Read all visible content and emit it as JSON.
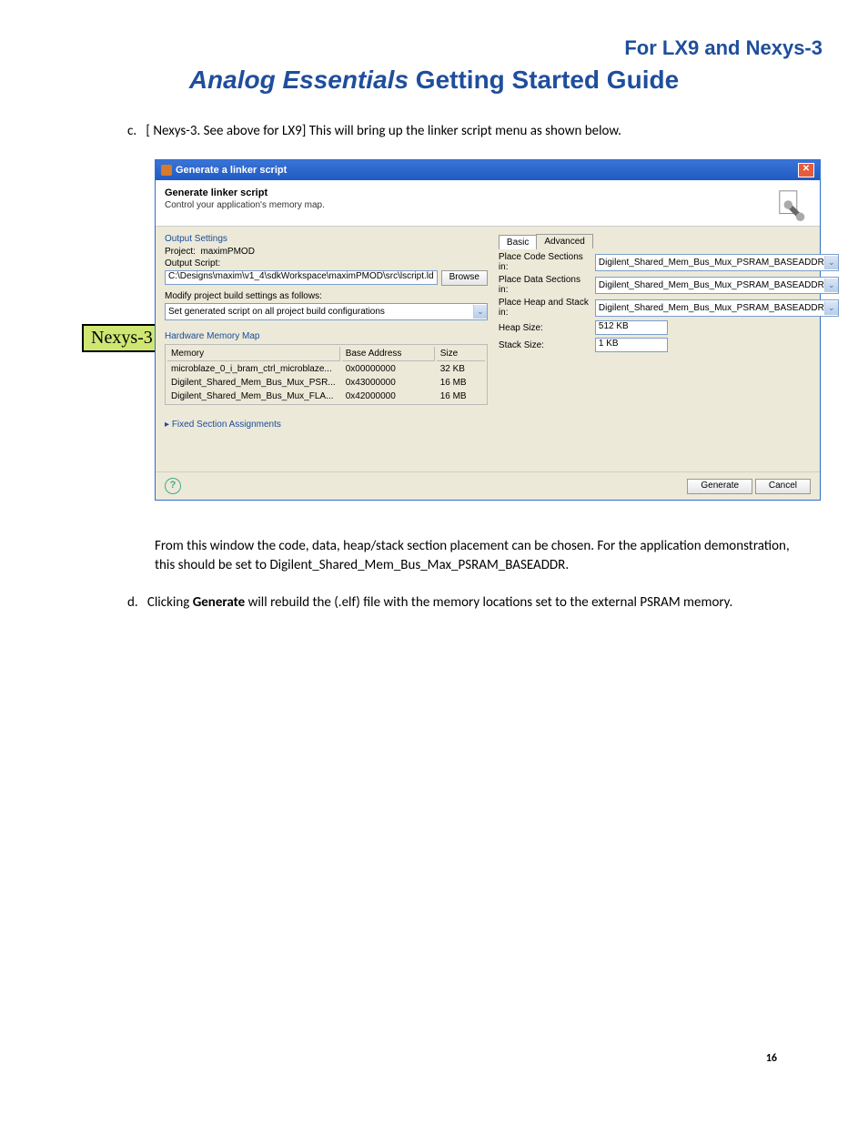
{
  "header": {
    "right": "For LX9 and Nexys-3",
    "title_italic": "Analog Essentials",
    "title_rest": " Getting Started Guide"
  },
  "sidebar_tag": "Nexys-3",
  "para_c_marker": "c.",
  "para_c": "[ Nexys-3. See above for LX9] This will bring up the linker script menu as shown below.",
  "para_after": "From this window the code, data, heap/stack section placement can be chosen. For the application demonstration, this should be set to Digilent_Shared_Mem_Bus_Max_PSRAM_BASEADDR.",
  "para_d_marker": "d.",
  "para_d_pre": "Clicking ",
  "para_d_bold": "Generate",
  "para_d_post": " will rebuild the (.elf) file with the memory locations set to the external PSRAM memory.",
  "page_number": "16",
  "dialog": {
    "title": "Generate a linker script",
    "heading": "Generate linker script",
    "subheading": "Control your application's memory map.",
    "output_settings": "Output Settings",
    "project_label": "Project:",
    "project_value": "maximPMOD",
    "output_script_label": "Output Script:",
    "output_script_value": "C:\\Designs\\maxim\\v1_4\\sdkWorkspace\\maximPMOD\\src\\lscript.ld",
    "browse": "Browse",
    "modify_label": "Modify project build settings as follows:",
    "modify_value": "Set generated script on all project build configurations",
    "hw_map": "Hardware Memory Map",
    "col_memory": "Memory",
    "col_base": "Base Address",
    "col_size": "Size",
    "rows": [
      {
        "mem": "microblaze_0_i_bram_ctrl_microblaze...",
        "base": "0x00000000",
        "size": "32 KB"
      },
      {
        "mem": "Digilent_Shared_Mem_Bus_Mux_PSR...",
        "base": "0x43000000",
        "size": "16 MB"
      },
      {
        "mem": "Digilent_Shared_Mem_Bus_Mux_FLA...",
        "base": "0x42000000",
        "size": "16 MB"
      }
    ],
    "fixed_assignments": "Fixed Section Assignments",
    "tab_basic": "Basic",
    "tab_advanced": "Advanced",
    "code_sections_label": "Place Code Sections in:",
    "data_sections_label": "Place Data Sections in:",
    "heap_stack_label": "Place Heap and Stack in:",
    "section_value": "Digilent_Shared_Mem_Bus_Mux_PSRAM_BASEADDR",
    "heap_size_label": "Heap Size:",
    "heap_size_value": "512 KB",
    "stack_size_label": "Stack Size:",
    "stack_size_value": "1 KB",
    "help": "?",
    "generate": "Generate",
    "cancel": "Cancel"
  }
}
